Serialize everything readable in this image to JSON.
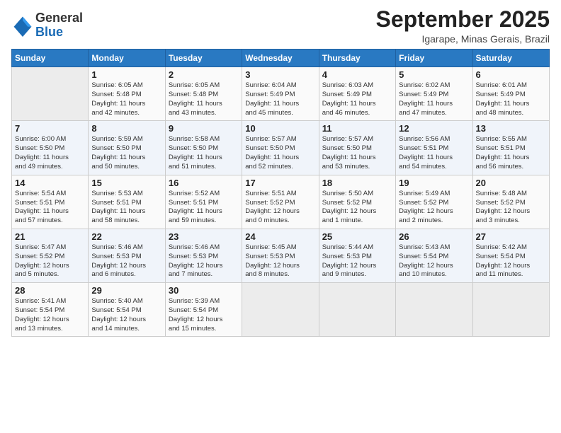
{
  "header": {
    "logo_general": "General",
    "logo_blue": "Blue",
    "title": "September 2025",
    "location": "Igarape, Minas Gerais, Brazil"
  },
  "days_of_week": [
    "Sunday",
    "Monday",
    "Tuesday",
    "Wednesday",
    "Thursday",
    "Friday",
    "Saturday"
  ],
  "weeks": [
    [
      {
        "day": "",
        "info": ""
      },
      {
        "day": "1",
        "info": "Sunrise: 6:05 AM\nSunset: 5:48 PM\nDaylight: 11 hours\nand 42 minutes."
      },
      {
        "day": "2",
        "info": "Sunrise: 6:05 AM\nSunset: 5:48 PM\nDaylight: 11 hours\nand 43 minutes."
      },
      {
        "day": "3",
        "info": "Sunrise: 6:04 AM\nSunset: 5:49 PM\nDaylight: 11 hours\nand 45 minutes."
      },
      {
        "day": "4",
        "info": "Sunrise: 6:03 AM\nSunset: 5:49 PM\nDaylight: 11 hours\nand 46 minutes."
      },
      {
        "day": "5",
        "info": "Sunrise: 6:02 AM\nSunset: 5:49 PM\nDaylight: 11 hours\nand 47 minutes."
      },
      {
        "day": "6",
        "info": "Sunrise: 6:01 AM\nSunset: 5:49 PM\nDaylight: 11 hours\nand 48 minutes."
      }
    ],
    [
      {
        "day": "7",
        "info": "Sunrise: 6:00 AM\nSunset: 5:50 PM\nDaylight: 11 hours\nand 49 minutes."
      },
      {
        "day": "8",
        "info": "Sunrise: 5:59 AM\nSunset: 5:50 PM\nDaylight: 11 hours\nand 50 minutes."
      },
      {
        "day": "9",
        "info": "Sunrise: 5:58 AM\nSunset: 5:50 PM\nDaylight: 11 hours\nand 51 minutes."
      },
      {
        "day": "10",
        "info": "Sunrise: 5:57 AM\nSunset: 5:50 PM\nDaylight: 11 hours\nand 52 minutes."
      },
      {
        "day": "11",
        "info": "Sunrise: 5:57 AM\nSunset: 5:50 PM\nDaylight: 11 hours\nand 53 minutes."
      },
      {
        "day": "12",
        "info": "Sunrise: 5:56 AM\nSunset: 5:51 PM\nDaylight: 11 hours\nand 54 minutes."
      },
      {
        "day": "13",
        "info": "Sunrise: 5:55 AM\nSunset: 5:51 PM\nDaylight: 11 hours\nand 56 minutes."
      }
    ],
    [
      {
        "day": "14",
        "info": "Sunrise: 5:54 AM\nSunset: 5:51 PM\nDaylight: 11 hours\nand 57 minutes."
      },
      {
        "day": "15",
        "info": "Sunrise: 5:53 AM\nSunset: 5:51 PM\nDaylight: 11 hours\nand 58 minutes."
      },
      {
        "day": "16",
        "info": "Sunrise: 5:52 AM\nSunset: 5:51 PM\nDaylight: 11 hours\nand 59 minutes."
      },
      {
        "day": "17",
        "info": "Sunrise: 5:51 AM\nSunset: 5:52 PM\nDaylight: 12 hours\nand 0 minutes."
      },
      {
        "day": "18",
        "info": "Sunrise: 5:50 AM\nSunset: 5:52 PM\nDaylight: 12 hours\nand 1 minute."
      },
      {
        "day": "19",
        "info": "Sunrise: 5:49 AM\nSunset: 5:52 PM\nDaylight: 12 hours\nand 2 minutes."
      },
      {
        "day": "20",
        "info": "Sunrise: 5:48 AM\nSunset: 5:52 PM\nDaylight: 12 hours\nand 3 minutes."
      }
    ],
    [
      {
        "day": "21",
        "info": "Sunrise: 5:47 AM\nSunset: 5:52 PM\nDaylight: 12 hours\nand 5 minutes."
      },
      {
        "day": "22",
        "info": "Sunrise: 5:46 AM\nSunset: 5:53 PM\nDaylight: 12 hours\nand 6 minutes."
      },
      {
        "day": "23",
        "info": "Sunrise: 5:46 AM\nSunset: 5:53 PM\nDaylight: 12 hours\nand 7 minutes."
      },
      {
        "day": "24",
        "info": "Sunrise: 5:45 AM\nSunset: 5:53 PM\nDaylight: 12 hours\nand 8 minutes."
      },
      {
        "day": "25",
        "info": "Sunrise: 5:44 AM\nSunset: 5:53 PM\nDaylight: 12 hours\nand 9 minutes."
      },
      {
        "day": "26",
        "info": "Sunrise: 5:43 AM\nSunset: 5:54 PM\nDaylight: 12 hours\nand 10 minutes."
      },
      {
        "day": "27",
        "info": "Sunrise: 5:42 AM\nSunset: 5:54 PM\nDaylight: 12 hours\nand 11 minutes."
      }
    ],
    [
      {
        "day": "28",
        "info": "Sunrise: 5:41 AM\nSunset: 5:54 PM\nDaylight: 12 hours\nand 13 minutes."
      },
      {
        "day": "29",
        "info": "Sunrise: 5:40 AM\nSunset: 5:54 PM\nDaylight: 12 hours\nand 14 minutes."
      },
      {
        "day": "30",
        "info": "Sunrise: 5:39 AM\nSunset: 5:54 PM\nDaylight: 12 hours\nand 15 minutes."
      },
      {
        "day": "",
        "info": ""
      },
      {
        "day": "",
        "info": ""
      },
      {
        "day": "",
        "info": ""
      },
      {
        "day": "",
        "info": ""
      }
    ]
  ]
}
